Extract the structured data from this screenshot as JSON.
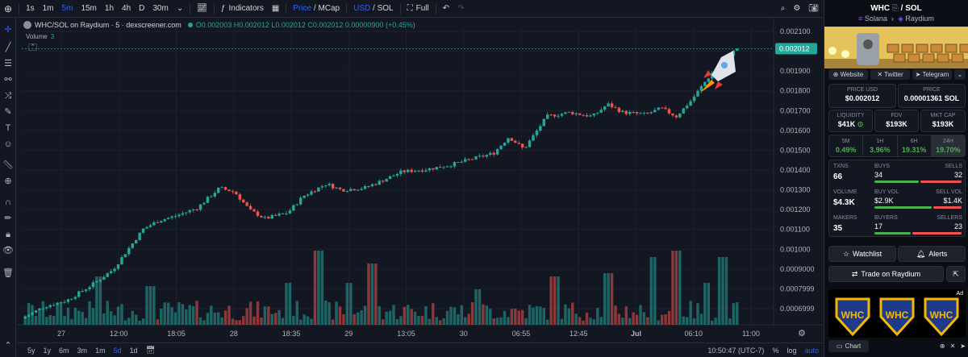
{
  "toolbar": {
    "add_icon": "plus-circle-icon",
    "intervals": [
      "1s",
      "1m",
      "5m",
      "15m",
      "1h",
      "4h",
      "D",
      "30m"
    ],
    "active_interval": "5m",
    "indicators_label": "Indicators",
    "price_label": "Price",
    "mcap_label": "MCap",
    "usd_label": "USD",
    "sol_label": "SOL",
    "full_label": "Full"
  },
  "legend": {
    "title": "WHC/SOL on Raydium · 5 · dexscreener.com",
    "ohlc": "O0.002003 H0.002012 L0.002012 C0.002012 0.00000900 (+0.45%)",
    "volume_label": "Volume",
    "volume_value": "3"
  },
  "chart_data": {
    "type": "candlestick",
    "y_ticks": [
      "0.002100",
      "0.002000",
      "0.001900",
      "0.001800",
      "0.001700",
      "0.001600",
      "0.001500",
      "0.001400",
      "0.001300",
      "0.001200",
      "0.001100",
      "0.001000",
      "0.0009000",
      "0.0007999",
      "0.0006999"
    ],
    "x_ticks": [
      "27",
      "12:00",
      "18:05",
      "28",
      "18:35",
      "29",
      "13:05",
      "30",
      "06:55",
      "12:45",
      "Jul",
      "06:10",
      "11:00"
    ],
    "last_price": "0.002012",
    "ylim": [
      0.00066,
      0.00212
    ],
    "colors": {
      "up": "#26a69a",
      "down": "#ef5350"
    },
    "price_path": [
      [
        0,
        0.00069
      ],
      [
        0.03,
        0.00075
      ],
      [
        0.06,
        0.00078
      ],
      [
        0.09,
        0.00085
      ],
      [
        0.12,
        0.00093
      ],
      [
        0.14,
        0.00103
      ],
      [
        0.16,
        0.00113
      ],
      [
        0.18,
        0.00117
      ],
      [
        0.2,
        0.00119
      ],
      [
        0.23,
        0.00123
      ],
      [
        0.26,
        0.00133
      ],
      [
        0.28,
        0.00131
      ],
      [
        0.3,
        0.00122
      ],
      [
        0.32,
        0.00118
      ],
      [
        0.35,
        0.00121
      ],
      [
        0.37,
        0.00129
      ],
      [
        0.4,
        0.00135
      ],
      [
        0.42,
        0.00132
      ],
      [
        0.45,
        0.00133
      ],
      [
        0.47,
        0.00136
      ],
      [
        0.5,
        0.00141
      ],
      [
        0.53,
        0.00142
      ],
      [
        0.56,
        0.00144
      ],
      [
        0.59,
        0.00147
      ],
      [
        0.62,
        0.0015
      ],
      [
        0.64,
        0.00158
      ],
      [
        0.66,
        0.00152
      ],
      [
        0.69,
        0.00168
      ],
      [
        0.72,
        0.0017
      ],
      [
        0.75,
        0.00168
      ],
      [
        0.77,
        0.00174
      ],
      [
        0.79,
        0.0017
      ],
      [
        0.82,
        0.00169
      ],
      [
        0.84,
        0.00172
      ],
      [
        0.86,
        0.00168
      ],
      [
        0.88,
        0.00176
      ],
      [
        0.9,
        0.00186
      ],
      [
        0.92,
        0.00195
      ],
      [
        0.94,
        0.002012
      ]
    ],
    "volume_spikes": [
      [
        0.1,
        0.5
      ],
      [
        0.17,
        0.35
      ],
      [
        0.35,
        0.4
      ],
      [
        0.39,
        0.9
      ],
      [
        0.43,
        0.4
      ],
      [
        0.46,
        0.7
      ],
      [
        0.6,
        0.3
      ],
      [
        0.7,
        0.5
      ],
      [
        0.77,
        0.55
      ],
      [
        0.83,
        0.8
      ],
      [
        0.86,
        0.9
      ],
      [
        0.9,
        0.4
      ],
      [
        0.92,
        0.8
      ]
    ]
  },
  "bottombar": {
    "ranges": [
      "5y",
      "1y",
      "6m",
      "3m",
      "1m",
      "5d",
      "1d"
    ],
    "active_range": "5d",
    "time": "10:50:47 (UTC-7)",
    "pct": "%",
    "log": "log",
    "auto": "auto"
  },
  "panel": {
    "title": "WHC",
    "pair_quote": "SOL",
    "chain": "Solana",
    "dex": "Raydium",
    "links": [
      "Website",
      "Twitter",
      "Telegram"
    ],
    "price_usd_label": "PRICE USD",
    "price_usd": "$0.002012",
    "price_label": "PRICE",
    "price_sol": "0.00001361 SOL",
    "liquidity_label": "LIQUIDITY",
    "liquidity": "$41K",
    "fdv_label": "FDV",
    "fdv": "$193K",
    "mcap_label": "MKT CAP",
    "mcap": "$193K",
    "changes": [
      {
        "label": "5M",
        "value": "0.49%"
      },
      {
        "label": "1H",
        "value": "3.96%"
      },
      {
        "label": "6H",
        "value": "19.31%"
      },
      {
        "label": "24H",
        "value": "19.70%"
      }
    ],
    "txns_label": "TXNS",
    "txns": "66",
    "buys_label": "BUYS",
    "buys": "34",
    "sells_label": "SELLS",
    "sells": "32",
    "volume_label": "VOLUME",
    "volume": "$4.3K",
    "buy_vol_label": "BUY VOL",
    "buy_vol": "$2.9K",
    "sell_vol_label": "SELL VOL",
    "sell_vol": "$1.4K",
    "makers_label": "MAKERS",
    "makers": "35",
    "buyers_label": "BUYERS",
    "buyers": "17",
    "sellers_label": "SELLERS",
    "sellers": "23",
    "watchlist_label": "Watchlist",
    "alerts_label": "Alerts",
    "trade_label": "Trade on Raydium",
    "ad_tag": "Ad",
    "ad_logo_text": "WHC",
    "chart_label": "Chart"
  }
}
